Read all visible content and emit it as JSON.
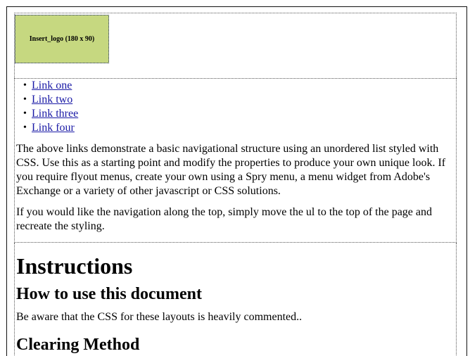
{
  "header": {
    "logo_placeholder": "Insert_logo (180 x 90)"
  },
  "sidebar": {
    "nav": [
      {
        "label": "Link one"
      },
      {
        "label": "Link two"
      },
      {
        "label": "Link three"
      },
      {
        "label": "Link four"
      }
    ],
    "paragraph1": "The above links demonstrate a basic navigational structure using an unordered list styled with CSS. Use this as a starting point and modify the properties to produce your own unique look. If you require flyout menus, create your own using a Spry menu, a menu widget from Adobe's Exchange or a variety of other javascript or CSS solutions.",
    "paragraph2": "If you would like the navigation along the top, simply move the ul to the top of the page and recreate the styling."
  },
  "content": {
    "heading": "Instructions",
    "subheading1": "How to use this document",
    "text1": "Be aware that the CSS for these layouts is heavily commented..",
    "subheading2": "Clearing Method"
  }
}
